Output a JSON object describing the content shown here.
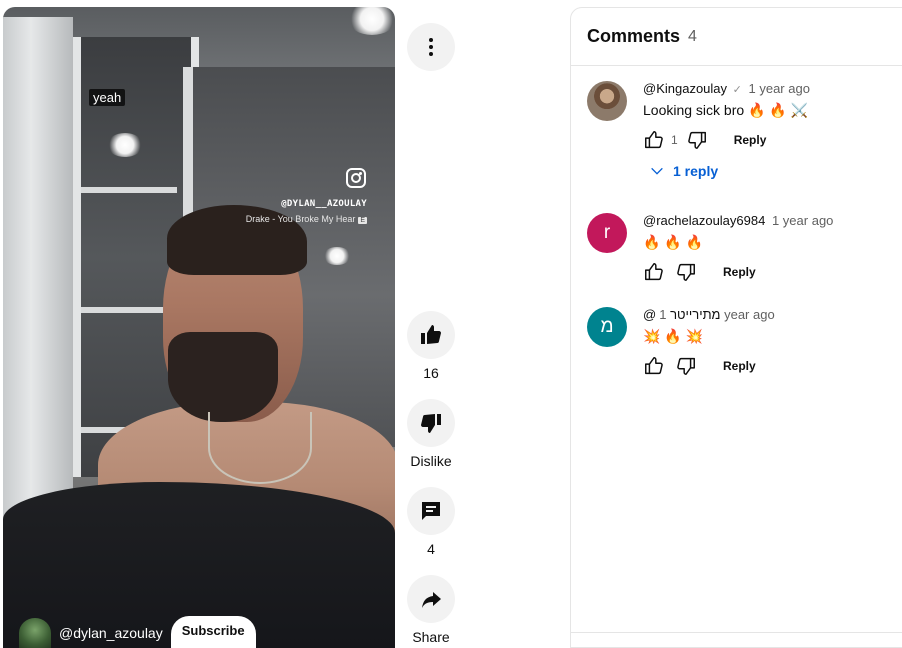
{
  "video": {
    "caption": "yeah",
    "overlay_handle": "@DYLAN__AZOULAY",
    "overlay_song": "Drake - You Broke My Hear",
    "explicit_badge": "E",
    "channel_name": "@dylan_azoulay",
    "subscribe_label": "Subscribe"
  },
  "actions": {
    "like_count": "16",
    "dislike_label": "Dislike",
    "comments_count": "4",
    "share_label": "Share"
  },
  "comments_panel": {
    "title": "Comments",
    "count": "4",
    "items": [
      {
        "author": "@Kingazoulay",
        "verified_mark": "✓",
        "time": "1 year ago",
        "text": "Looking sick bro 🔥 🔥 ⚔️",
        "likes": "1",
        "reply_label": "Reply",
        "replies_label": "1 reply",
        "avatar_initial": ""
      },
      {
        "author": "@rachelazoulay6984",
        "time": "1 year ago",
        "text": "🔥 🔥 🔥",
        "reply_label": "Reply",
        "avatar_initial": "r",
        "avatar_color": "#c2185b"
      },
      {
        "author": "@מתירייטר",
        "time": "1 year ago",
        "text": "💥 🔥 💥",
        "reply_label": "Reply",
        "avatar_initial": "מ",
        "avatar_color": "#00838f"
      }
    ]
  },
  "icons": {
    "menu": "more-vert-icon",
    "like": "thumb-up-icon",
    "dislike": "thumb-down-icon",
    "comments": "comment-icon",
    "share": "share-icon",
    "instagram": "instagram-icon"
  }
}
